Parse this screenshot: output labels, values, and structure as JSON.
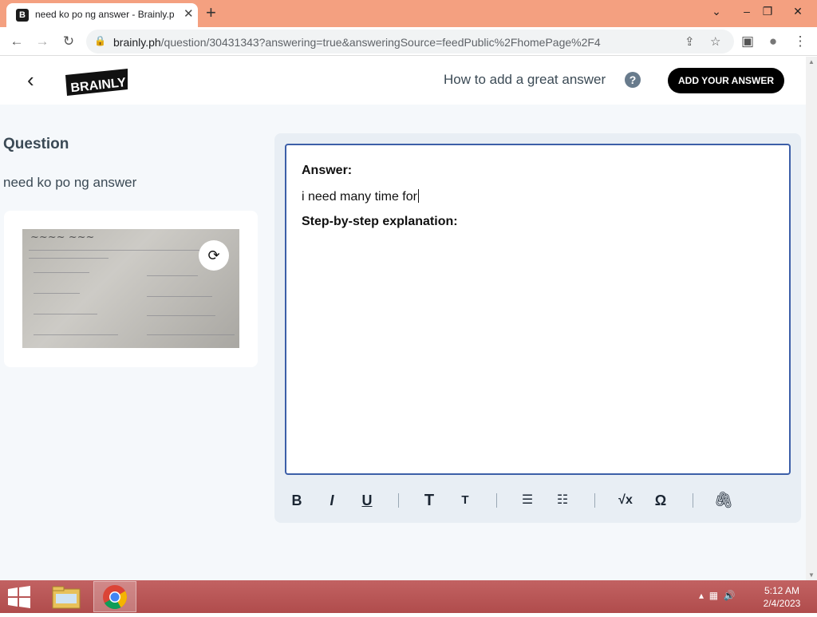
{
  "browser": {
    "tab_title": "need ko po ng answer - Brainly.ph",
    "tab_favicon": "B",
    "url_host": "brainly.ph",
    "url_path": "/question/30431343?answering=true&answeringSource=feedPublic%2FhomePage%2F4"
  },
  "header": {
    "logo_text": "BRAINLY",
    "how_to_label": "How to add a great answer",
    "help_icon": "?",
    "add_answer_button": "ADD YOUR ANSWER"
  },
  "question": {
    "heading": "Question",
    "text": "need ko po ng answer"
  },
  "editor": {
    "answer_label": "Answer:",
    "answer_text": "i need many time for",
    "step_label": "Step-by-step explanation:"
  },
  "format_toolbar": {
    "bold": "B",
    "italic": "I",
    "underline": "U",
    "heading_large": "T",
    "heading_small": "T",
    "sqrt": "√x",
    "omega": "Ω"
  },
  "taskbar": {
    "time": "5:12 AM",
    "date": "2/4/2023"
  },
  "colors": {
    "tabstrip": "#f4a080",
    "brand_black": "#000000",
    "editor_border": "#3c5fa8",
    "taskbar": "#b85656"
  }
}
